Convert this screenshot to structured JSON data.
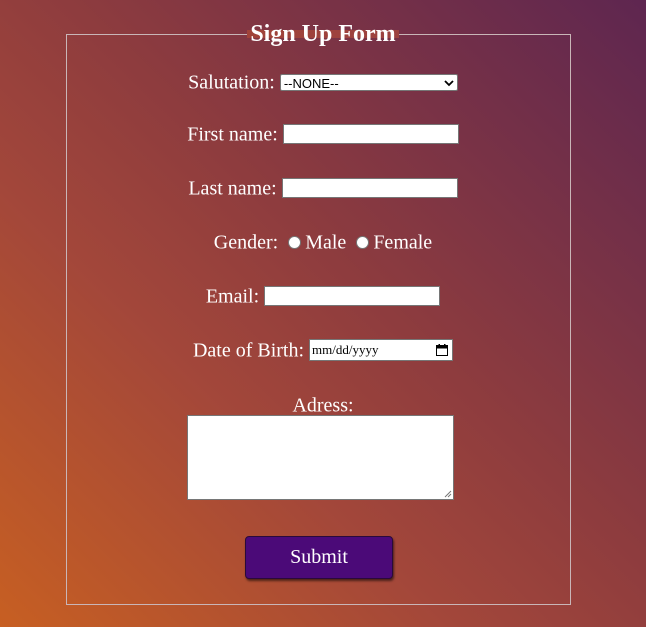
{
  "form": {
    "legend": "Sign Up Form",
    "salutation": {
      "label": "Salutation:",
      "selected": "--NONE--"
    },
    "first_name": {
      "label": "First name:",
      "value": ""
    },
    "last_name": {
      "label": "Last name:",
      "value": ""
    },
    "gender": {
      "label": "Gender:",
      "options": [
        "Male",
        "Female"
      ]
    },
    "email": {
      "label": "Email:",
      "value": ""
    },
    "dob": {
      "label": "Date of Birth:",
      "placeholder": "mm/dd/yyyy"
    },
    "address": {
      "label": "Adress:",
      "value": ""
    },
    "submit_label": "Submit"
  },
  "colors": {
    "submit_bg": "#4b0a78",
    "text": "#ffffff",
    "gradient_start": "#c75f22",
    "gradient_end": "#5e2650"
  },
  "icons": {
    "select_arrow": "chevron-down-icon",
    "date_picker": "calendar-icon",
    "resize": "resize-grip-icon"
  }
}
